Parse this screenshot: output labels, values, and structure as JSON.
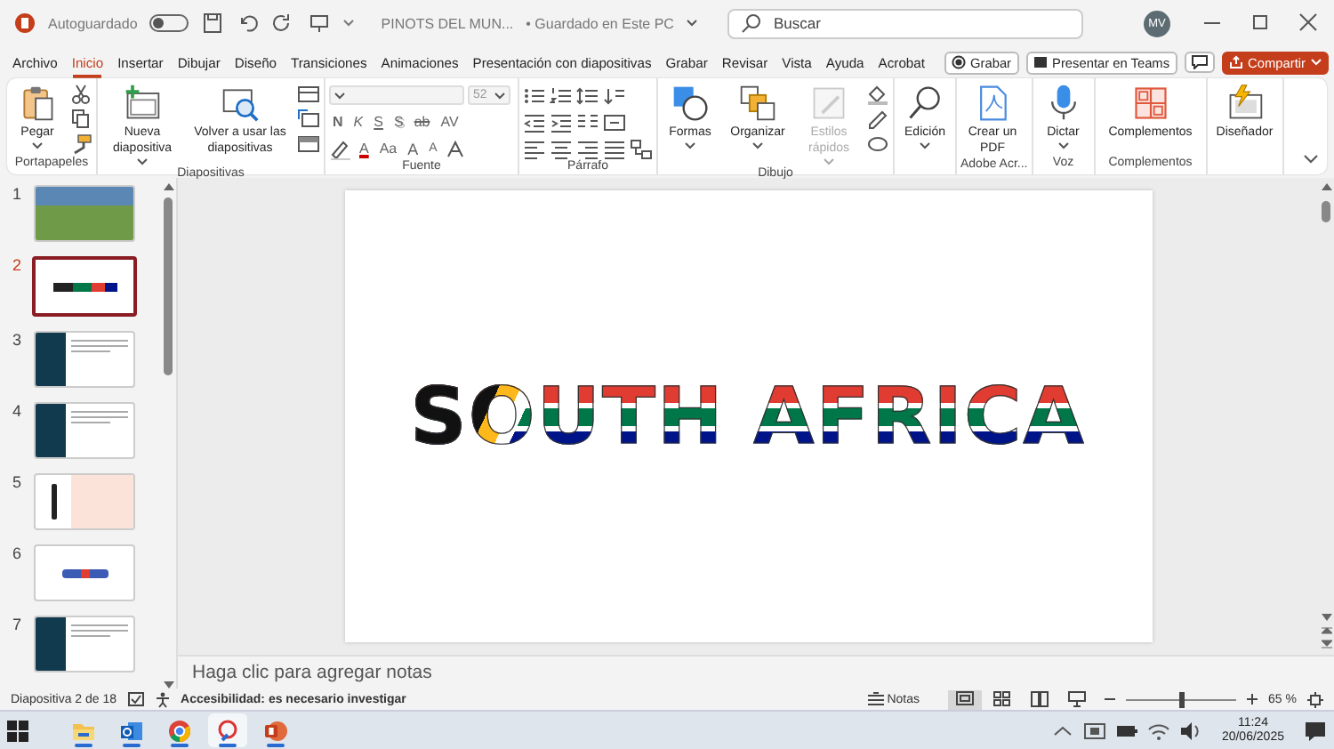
{
  "title_bar": {
    "autosave_label": "Autoguardado",
    "autosave_on": false,
    "document_title": "PINOTS DEL MUN...",
    "save_status": "• Guardado en Este PC",
    "search": {
      "placeholder": "Buscar"
    },
    "avatar_initials": "MV"
  },
  "menu_tabs": [
    {
      "label": "Archivo",
      "selected": false
    },
    {
      "label": "Inicio",
      "selected": true
    },
    {
      "label": "Insertar",
      "selected": false
    },
    {
      "label": "Dibujar",
      "selected": false
    },
    {
      "label": "Diseño",
      "selected": false
    },
    {
      "label": "Transiciones",
      "selected": false
    },
    {
      "label": "Animaciones",
      "selected": false
    },
    {
      "label": "Presentación con diapositivas",
      "selected": false
    },
    {
      "label": "Grabar",
      "selected": false
    },
    {
      "label": "Revisar",
      "selected": false
    },
    {
      "label": "Vista",
      "selected": false
    },
    {
      "label": "Ayuda",
      "selected": false
    },
    {
      "label": "Acrobat",
      "selected": false
    }
  ],
  "header_buttons": [
    {
      "label": "Grabar",
      "kind": "record"
    },
    {
      "label": "Presentar en Teams",
      "kind": "teams"
    },
    {
      "kind": "comments"
    },
    {
      "label": "Compartir",
      "kind": "share"
    }
  ],
  "ribbon": {
    "groups": [
      {
        "label": "Portapapeles",
        "kind": "clipboard",
        "buttons": [
          {
            "label": "Pegar",
            "disabled": false
          }
        ]
      },
      {
        "label": "Diapositivas",
        "kind": "slides",
        "buttons": [
          {
            "label": "Nueva diapositiva",
            "disabled": false
          },
          {
            "label": "Volver a usar las diapositivas",
            "disabled": false
          }
        ]
      },
      {
        "label": "Fuente",
        "kind": "font",
        "font_size": "52",
        "format_buttons": [
          {
            "text": "N",
            "kind": "bold"
          },
          {
            "text": "K",
            "kind": "italic"
          },
          {
            "text": "S",
            "kind": "underline"
          },
          {
            "text": "S",
            "kind": "shadow"
          },
          {
            "text": "ab",
            "kind": "strike"
          },
          {
            "text": "AV",
            "kind": "spacing"
          }
        ],
        "color_buttons": [
          {
            "text": "A",
            "kind": "color"
          },
          {
            "text": "Aa",
            "kind": "case"
          },
          {
            "text": "A",
            "kind": "grow"
          },
          {
            "text": "A",
            "kind": "shrink"
          }
        ]
      },
      {
        "label": "Párrafo",
        "kind": "paragraph"
      },
      {
        "label": "Dibujo",
        "kind": "drawing",
        "buttons": [
          {
            "label": "Formas",
            "disabled": false
          },
          {
            "label": "Organizar",
            "disabled": false
          },
          {
            "label": "Estilos rápidos",
            "disabled": true
          }
        ]
      },
      {
        "kind": "editing",
        "buttons": [
          {
            "label": "Edición",
            "disabled": false
          }
        ]
      },
      {
        "label": "Adobe Acr...",
        "kind": "adobe",
        "buttons": [
          {
            "label": "Crear un PDF",
            "disabled": false
          }
        ]
      },
      {
        "label": "Voz",
        "kind": "voice",
        "buttons": [
          {
            "label": "Dictar",
            "disabled": false
          }
        ]
      },
      {
        "label": "Complementos",
        "kind": "addins",
        "buttons": [
          {
            "label": "Complementos",
            "disabled": false
          }
        ]
      },
      {
        "kind": "designer",
        "buttons": [
          {
            "label": "Diseñador",
            "disabled": false
          }
        ]
      }
    ]
  },
  "slides": [
    {
      "number": "1",
      "kind": "photo",
      "selected": false
    },
    {
      "number": "2",
      "kind": "flag-title",
      "selected": true
    },
    {
      "number": "3",
      "kind": "dark-text",
      "selected": false
    },
    {
      "number": "4",
      "kind": "dark-text",
      "selected": false
    },
    {
      "number": "5",
      "kind": "bottle",
      "selected": false
    },
    {
      "number": "6",
      "kind": "logo",
      "selected": false
    },
    {
      "number": "7",
      "kind": "dark-text",
      "selected": false
    }
  ],
  "slide": {
    "title": "SOUTH AFRICA"
  },
  "notes": {
    "placeholder": "Haga clic para agregar notas"
  },
  "status_bar": {
    "slide_counter": "Diapositiva 2 de 18",
    "accessibility": "Accesibilidad: es necesario investigar",
    "notes_button": "Notas",
    "views": [
      {
        "kind": "normal",
        "selected": true
      },
      {
        "kind": "sorter",
        "selected": false
      },
      {
        "kind": "reading",
        "selected": false
      },
      {
        "kind": "slideshow",
        "selected": false
      }
    ],
    "zoom": {
      "level": 0.5,
      "label": "65 %"
    }
  },
  "taskbar": {
    "apps": [
      {
        "kind": "explorer",
        "running": true,
        "selected": false
      },
      {
        "kind": "outlook",
        "running": true,
        "selected": false
      },
      {
        "kind": "chrome",
        "running": true,
        "selected": false
      },
      {
        "kind": "tool",
        "running": true,
        "selected": true
      },
      {
        "kind": "powerpoint",
        "running": true,
        "selected": false
      }
    ],
    "clock": {
      "time": "11:24",
      "date": "20/06/2025"
    }
  }
}
